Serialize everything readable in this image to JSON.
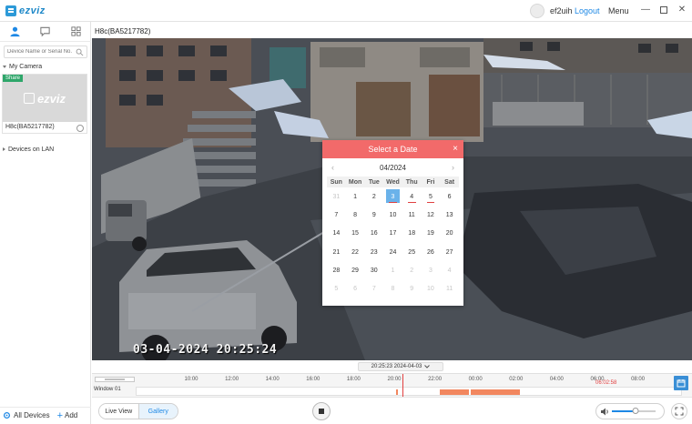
{
  "app": {
    "brand": "ezviz"
  },
  "header": {
    "username": "ef2uih",
    "logout": "Logout",
    "menu": "Menu"
  },
  "sidebar": {
    "search_placeholder": "Device Name or Serial No.",
    "my_camera": "My Camera",
    "camera": {
      "share_badge": "Share",
      "thumb_brand": "ezviz",
      "name": "H8c(BA5217782)"
    },
    "devices_on_lan": "Devices on LAN",
    "all_devices": "All Devices",
    "add": "Add"
  },
  "main": {
    "camera_title": "H8c(BA5217782)",
    "osd_timestamp": "03-04-2024 20:25:24"
  },
  "datepicker": {
    "title": "Select a Date",
    "close": "×",
    "prev": "‹",
    "next": "›",
    "month": "04/2024",
    "weekdays": [
      "Sun",
      "Mon",
      "Tue",
      "Wed",
      "Thu",
      "Fri",
      "Sat"
    ],
    "days": [
      {
        "d": "31",
        "m": true
      },
      {
        "d": "1"
      },
      {
        "d": "2"
      },
      {
        "d": "3",
        "sel": true,
        "mark": true
      },
      {
        "d": "4",
        "mark": true
      },
      {
        "d": "5",
        "mark": true
      },
      {
        "d": "6"
      },
      {
        "d": "7"
      },
      {
        "d": "8"
      },
      {
        "d": "9"
      },
      {
        "d": "10"
      },
      {
        "d": "11"
      },
      {
        "d": "12"
      },
      {
        "d": "13"
      },
      {
        "d": "14"
      },
      {
        "d": "15"
      },
      {
        "d": "16"
      },
      {
        "d": "17"
      },
      {
        "d": "18"
      },
      {
        "d": "19"
      },
      {
        "d": "20"
      },
      {
        "d": "21"
      },
      {
        "d": "22"
      },
      {
        "d": "23"
      },
      {
        "d": "24"
      },
      {
        "d": "25"
      },
      {
        "d": "26"
      },
      {
        "d": "27"
      },
      {
        "d": "28"
      },
      {
        "d": "29"
      },
      {
        "d": "30"
      },
      {
        "d": "1",
        "m": true
      },
      {
        "d": "2",
        "m": true
      },
      {
        "d": "3",
        "m": true
      },
      {
        "d": "4",
        "m": true
      },
      {
        "d": "5",
        "m": true
      },
      {
        "d": "6",
        "m": true
      },
      {
        "d": "7",
        "m": true
      },
      {
        "d": "8",
        "m": true
      },
      {
        "d": "9",
        "m": true
      },
      {
        "d": "10",
        "m": true
      },
      {
        "d": "11",
        "m": true
      }
    ]
  },
  "timeline": {
    "current": "20:25:23  2024-04-03",
    "window_label": "Window 01",
    "ticks": [
      "10:00",
      "12:00",
      "14:00",
      "16:00",
      "18:00",
      "20:00",
      "22:00",
      "00:00",
      "02:00",
      "04:00",
      "06:00",
      "08:00"
    ],
    "playhead_time": "06:02:58"
  },
  "controls": {
    "live_view": "Live View",
    "gallery": "Gallery",
    "volume_percent": 55
  },
  "colors": {
    "accent": "#1e88e5",
    "datepicker_header": "#f26a6a",
    "recording_segment": "#f2875f",
    "selected_day": "#6ab2ea"
  }
}
